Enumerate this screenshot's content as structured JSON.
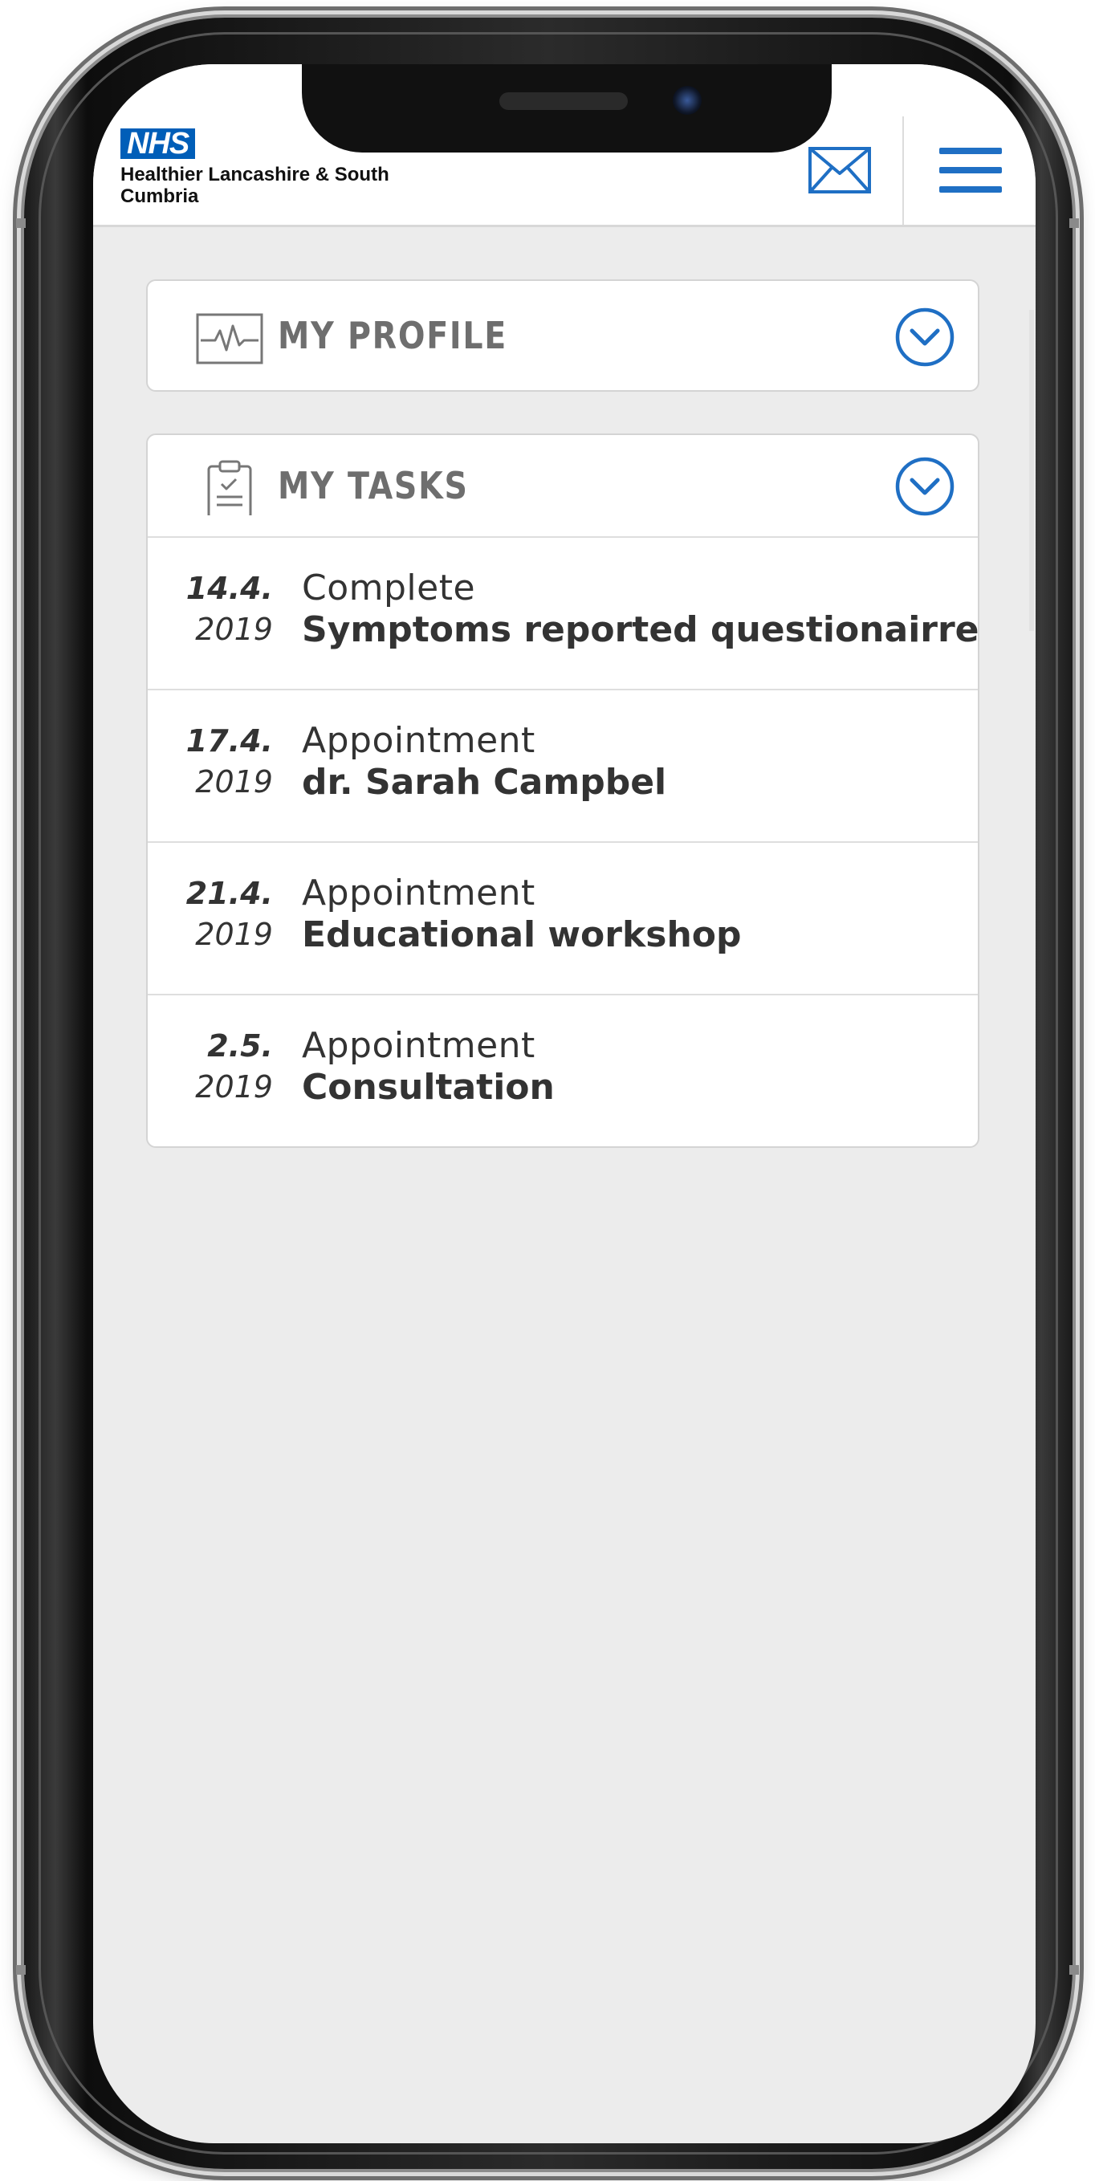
{
  "header": {
    "logo_badge": "NHS",
    "org_name": "Healthier Lancashire & South Cumbria",
    "mail_icon": "envelope-icon",
    "menu_icon": "hamburger-menu-icon"
  },
  "colors": {
    "accent": "#005eb8",
    "icon_blue": "#1f6fc4",
    "background": "#ececec",
    "panel_title": "#6e6e6e"
  },
  "profile": {
    "title": "MY PROFILE",
    "icon": "heartbeat-icon",
    "toggle_icon": "chevron-down-circle-icon"
  },
  "tasks": {
    "title": "MY TASKS",
    "icon": "clipboard-check-icon",
    "toggle_icon": "chevron-down-circle-icon",
    "items": [
      {
        "day": "14.4.",
        "year": "2019",
        "type": "Complete",
        "title": "Symptoms reported questionairre"
      },
      {
        "day": "17.4.",
        "year": "2019",
        "type": "Appointment",
        "title": "dr. Sarah Campbel"
      },
      {
        "day": "21.4.",
        "year": "2019",
        "type": "Appointment",
        "title": "Educational workshop"
      },
      {
        "day": "2.5.",
        "year": "2019",
        "type": "Appointment",
        "title": "Consultation"
      }
    ]
  }
}
